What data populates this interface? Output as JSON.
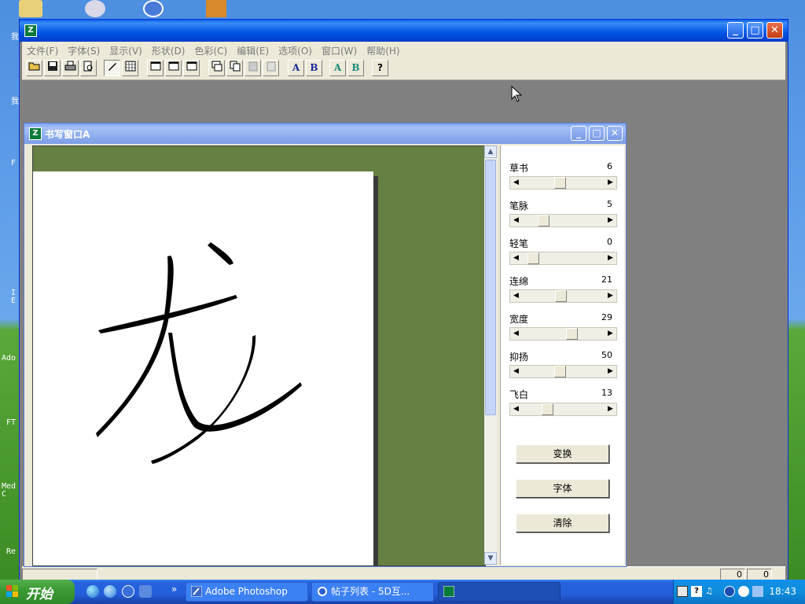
{
  "desktop": {
    "labels": [
      "我",
      "我",
      "F",
      "I\nE",
      "Ado",
      "FT",
      "Med\nC",
      "Re"
    ]
  },
  "main_window": {
    "menu": [
      "文件(F)",
      "字体(S)",
      "显示(V)",
      "形状(D)",
      "色彩(C)",
      "编辑(E)",
      "选项(O)",
      "窗口(W)",
      "帮助(H)"
    ],
    "toolbar": {
      "open_icon": "folder-open-icon",
      "save_icon": "save-icon",
      "print_icon": "print-icon",
      "preview_icon": "print-preview-icon",
      "pen_icon": "pen-icon",
      "grid_icon": "grid-icon",
      "font_a": "A",
      "font_b": "B",
      "color_a": "A",
      "color_b": "B",
      "help": "?"
    },
    "status": [
      "0",
      "0"
    ]
  },
  "child_window": {
    "title": "书写窗口A",
    "params": [
      {
        "label": "草书",
        "value": "6",
        "level": 0.45
      },
      {
        "label": "笔脉",
        "value": "5",
        "level": 0.22
      },
      {
        "label": "轻笔",
        "value": "0",
        "level": 0.08
      },
      {
        "label": "连绵",
        "value": "21",
        "level": 0.47
      },
      {
        "label": "宽度",
        "value": "29",
        "level": 0.62
      },
      {
        "label": "抑扬",
        "value": "50",
        "level": 0.45
      },
      {
        "label": "飞白",
        "value": "13",
        "level": 0.28
      }
    ],
    "buttons": [
      "变换",
      "字体",
      "清除"
    ]
  },
  "taskbar": {
    "start_label": "开始",
    "tasks": [
      "Adobe Photoshop",
      "帖子列表 - 5D互...",
      ""
    ],
    "clock": "18:43",
    "quick_launch_more": "»"
  }
}
